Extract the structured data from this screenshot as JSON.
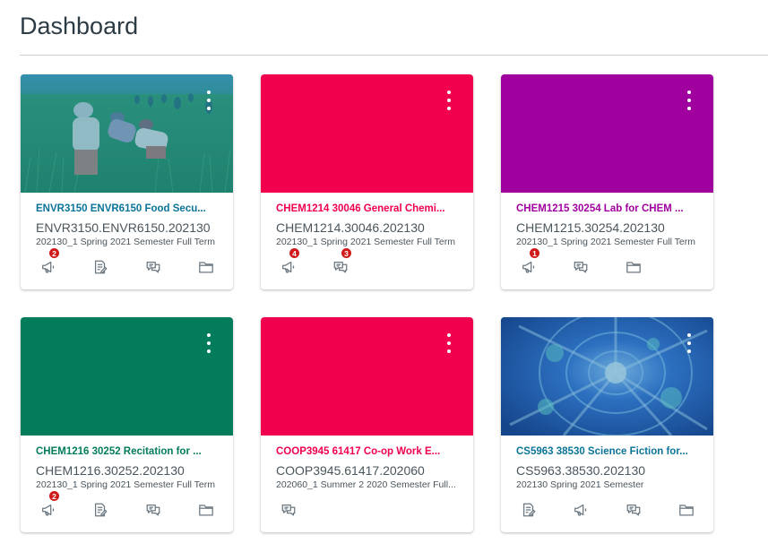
{
  "page": {
    "title": "Dashboard"
  },
  "cards": [
    {
      "title": "ENVR3150 ENVR6150 Food Secu...",
      "code": "ENVR3150.ENVR6150.202130",
      "term": "202130_1 Spring 2021 Semester Full Term",
      "color": "#0b7498",
      "hero": "photo-rice-field",
      "actions": [
        {
          "icon": "announcements-icon",
          "badge": "2"
        },
        {
          "icon": "assignments-icon",
          "badge": ""
        },
        {
          "icon": "discussions-icon",
          "badge": ""
        },
        {
          "icon": "files-icon",
          "badge": ""
        }
      ]
    },
    {
      "title": "CHEM1214 30046 General Chemi...",
      "code": "CHEM1214.30046.202130",
      "term": "202130_1 Spring 2021 Semester Full Term",
      "color": "#f0004d",
      "hero": "solid",
      "actions": [
        {
          "icon": "announcements-icon",
          "badge": "4"
        },
        {
          "icon": "discussions-icon",
          "badge": "3"
        }
      ]
    },
    {
      "title": "CHEM1215 30254 Lab for CHEM ...",
      "code": "CHEM1215.30254.202130",
      "term": "202130_1 Spring 2021 Semester Full Term",
      "color": "#a0019e",
      "hero": "solid",
      "actions": [
        {
          "icon": "announcements-icon",
          "badge": "1"
        },
        {
          "icon": "discussions-icon",
          "badge": ""
        },
        {
          "icon": "files-icon",
          "badge": ""
        }
      ]
    },
    {
      "title": "CHEM1216 30252 Recitation for ...",
      "code": "CHEM1216.30252.202130",
      "term": "202130_1 Spring 2021 Semester Full Term",
      "color": "#037c5b",
      "hero": "solid",
      "actions": [
        {
          "icon": "announcements-icon",
          "badge": "2"
        },
        {
          "icon": "assignments-icon",
          "badge": ""
        },
        {
          "icon": "discussions-icon",
          "badge": ""
        },
        {
          "icon": "files-icon",
          "badge": ""
        }
      ]
    },
    {
      "title": "COOP3945 61417 Co-op Work E...",
      "code": "COOP3945.61417.202060",
      "term": "202060_1 Summer 2 2020 Semester Full...",
      "color": "#f0004d",
      "hero": "solid",
      "actions": [
        {
          "icon": "discussions-icon",
          "badge": ""
        }
      ]
    },
    {
      "title": "CS5963 38530 Science Fiction for...",
      "code": "CS5963.38530.202130",
      "term": "202130 Spring 2021 Semester",
      "color": "#0b7498",
      "hero": "photo-abstract",
      "actions": [
        {
          "icon": "assignments-icon",
          "badge": ""
        },
        {
          "icon": "announcements-icon",
          "badge": ""
        },
        {
          "icon": "discussions-icon",
          "badge": ""
        },
        {
          "icon": "files-icon",
          "badge": ""
        }
      ]
    }
  ]
}
